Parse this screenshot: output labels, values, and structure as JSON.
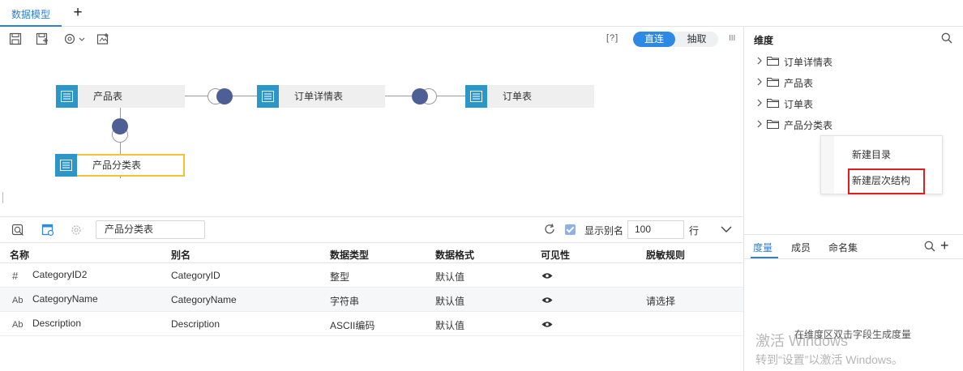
{
  "tabs": [
    {
      "label": "数据模型"
    }
  ],
  "toolbar": {
    "help_label": "[?]",
    "mode_direct": "直连",
    "mode_extract": "抽取",
    "columns_icon": "III"
  },
  "diagram": {
    "nodes": [
      {
        "label": "产品表"
      },
      {
        "label": "订单详情表"
      },
      {
        "label": "订单表"
      },
      {
        "label": "产品分类表"
      }
    ]
  },
  "fields_toolbar": {
    "table_name": "产品分类表",
    "show_alias_label": "显示别名",
    "show_alias_checked": true,
    "rows_value": "100",
    "rows_unit": "行"
  },
  "table": {
    "columns": [
      "名称",
      "别名",
      "数据类型",
      "数据格式",
      "可见性",
      "脱敏规则"
    ],
    "rows": [
      {
        "icon": "#",
        "name": "CategoryID2",
        "alias": "CategoryID",
        "type": "整型",
        "format": "默认值",
        "mask": ""
      },
      {
        "icon": "Ab",
        "name": "CategoryName",
        "alias": "CategoryName",
        "type": "字符串",
        "format": "默认值",
        "mask": "请选择"
      },
      {
        "icon": "Ab",
        "name": "Description",
        "alias": "Description",
        "type": "ASCII编码",
        "format": "默认值",
        "mask": ""
      }
    ]
  },
  "dimension_panel": {
    "title": "维度",
    "tree": [
      {
        "label": "订单详情表"
      },
      {
        "label": "产品表"
      },
      {
        "label": "订单表"
      },
      {
        "label": "产品分类表"
      }
    ],
    "context_menu": [
      {
        "label": "新建目录"
      },
      {
        "label": "新建层次结构"
      }
    ]
  },
  "measure_panel": {
    "tabs": [
      {
        "label": "度量"
      },
      {
        "label": "成员"
      },
      {
        "label": "命名集"
      }
    ],
    "hint": "在维度区双击字段生成度量"
  },
  "watermark": {
    "line1": "激活 Windows",
    "line2": "转到“设置”以激活 Windows。"
  },
  "colors": {
    "accent": "#2e88e6",
    "node_icon": "#2b97c9",
    "joint": "#4d5f94",
    "selected_border": "#f0c332",
    "highlight": "#e01e1e"
  }
}
